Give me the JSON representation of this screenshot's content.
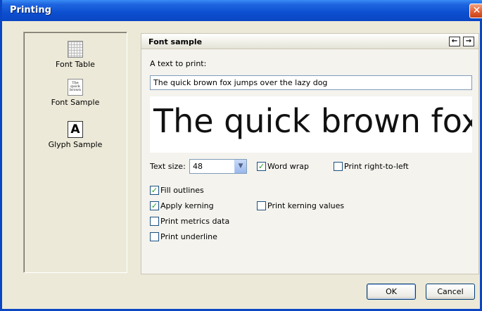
{
  "window": {
    "title": "Printing",
    "close_icon": "close-icon"
  },
  "sidebar": {
    "items": [
      {
        "label": "Font Table",
        "icon": "font-table-icon"
      },
      {
        "label": "Font Sample",
        "icon": "font-sample-icon",
        "icon_text": [
          "The",
          "quick",
          "brown"
        ]
      },
      {
        "label": "Glyph Sample",
        "icon": "glyph-sample-icon",
        "icon_text": "A"
      }
    ]
  },
  "panel": {
    "title": "Font sample",
    "nav": {
      "back_icon": "arrow-left-icon",
      "back_glyph": "←",
      "forward_icon": "arrow-right-icon",
      "forward_glyph": "→"
    },
    "text_label": "A text to print:",
    "text_value": "The quick brown fox jumps over the lazy dog",
    "preview_text": "The quick brown fox jumps over the lazy dog",
    "text_size_label": "Text size:",
    "text_size_value": "48",
    "options": {
      "word_wrap": {
        "label": "Word wrap",
        "checked": true
      },
      "print_rtl": {
        "label": "Print right-to-left",
        "checked": false
      },
      "fill_outlines": {
        "label": "Fill outlines",
        "checked": true
      },
      "apply_kerning": {
        "label": "Apply kerning",
        "checked": true
      },
      "print_kerning_values": {
        "label": "Print kerning values",
        "checked": false
      },
      "print_metrics": {
        "label": "Print metrics data",
        "checked": false
      },
      "print_underline": {
        "label": "Print underline",
        "checked": false
      }
    }
  },
  "buttons": {
    "ok": "OK",
    "cancel": "Cancel"
  },
  "colors": {
    "titlebar": "#0a46c4",
    "check": "#21a121"
  }
}
